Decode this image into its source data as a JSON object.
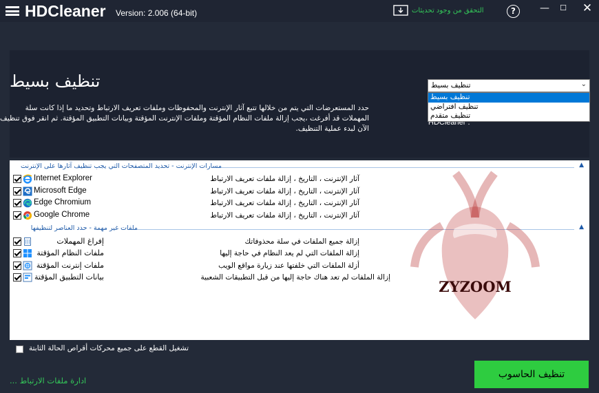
{
  "titlebar": {
    "app_name": "HDCleaner",
    "version": "Version: 2.006 (64-bit)",
    "update_link": "التحقق من وجود تحديثات",
    "help": "?",
    "minimize": "—",
    "maximize": "☐",
    "close": "✕"
  },
  "header": {
    "title": "تنظيف بسيط",
    "description_lines": [
      "حدد المستعرضات التي يتم من خلالها تتبع آثار الإنترنت والمحفوظات وملفات تعريف الارتباط وتحديد ما إذا كانت سلة",
      "المهملات قد أفرغت ،يجب إزالة ملفات النظام المؤقتة وملفات الإنترنت المؤقتة وبيانات التطبيق المؤقتة. ثم انقر فوق تنظيف",
      "الآن لبدء عملية التنظيف."
    ],
    "hidden_tail": "HDCleaner ."
  },
  "mode_select": {
    "selected": "تنظيف بسيط",
    "options": [
      "تنظيف بسيط",
      "تنظيف افتراضي",
      "تنظيف متقدم"
    ],
    "active_index": 0
  },
  "groups": [
    {
      "title": "مسارات الإنترنت - تحديد المتصفحات التي يجب تنظيف آثارها على الإنترنت",
      "items": [
        {
          "name": "Internet Explorer",
          "desc": "آثار الإنترنت ، التاريخ ، إزالة ملفات تعريف الارتباط",
          "icon": "internet-explorer-icon",
          "checked": true
        },
        {
          "name": "Microsoft Edge",
          "desc": "آثار الإنترنت ، التاريخ ، إزالة ملفات تعريف الارتباط",
          "icon": "edge-legacy-icon",
          "checked": true
        },
        {
          "name": "Edge Chromium",
          "desc": "آثار الإنترنت ، التاريخ ، إزالة ملفات تعريف الارتباط",
          "icon": "edge-chromium-icon",
          "checked": true
        },
        {
          "name": "Google Chrome",
          "desc": "آثار الإنترنت ، التاريخ ، إزالة ملفات تعريف الارتباط",
          "icon": "chrome-icon",
          "checked": true
        }
      ]
    },
    {
      "title": "ملفات غير مهمة - حدد العناصر لتنظيفها",
      "items": [
        {
          "name": "إفراغ المهملات",
          "desc": "إزالة جميع الملفات في سلة محذوفاتك",
          "icon": "recycle-bin-icon",
          "checked": true
        },
        {
          "name": "ملفات النظام المؤقتة",
          "desc": "إزالة الملفات التي لم يعد النظام في حاجة إليها",
          "icon": "windows-icon",
          "checked": true
        },
        {
          "name": "ملفات إنترنت المؤقتة",
          "desc": "أزلة الملفات التي خلفتها عند زيارة مواقع الويب",
          "icon": "internet-files-icon",
          "checked": true
        },
        {
          "name": "بيانات التطبيق المؤقتة",
          "desc": "إزالة الملفات لم تعد هناك حاجة إليها من قبل التطبيقات الشعبية",
          "icon": "app-data-icon",
          "checked": true
        }
      ]
    }
  ],
  "watermark": {
    "text": "ZYZOOM"
  },
  "footer": {
    "ssd_label": "تشغيل القطع على جميع محركات أقراص الحالة الثابتة",
    "ssd_checked": false,
    "cookies_link": "ادارة ملفات الارتباط ...",
    "clean_button": "تنظيف الحاسوب"
  },
  "colors": {
    "background": "#232a38",
    "accent_green": "#2ecc40",
    "link_green": "#34c759",
    "group_blue": "#1e5aa8",
    "selection_blue": "#0078d7"
  }
}
